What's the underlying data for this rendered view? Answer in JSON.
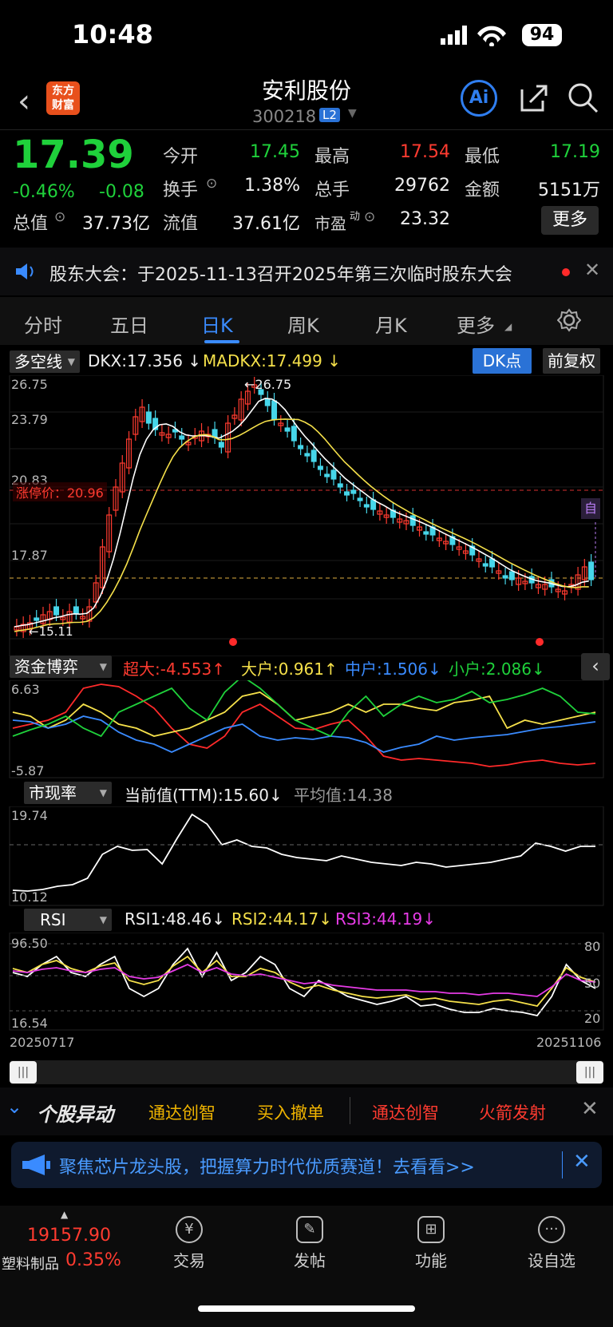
{
  "status": {
    "time": "10:48",
    "battery": "94"
  },
  "header": {
    "logo_line1": "东方",
    "logo_line2": "财富",
    "name": "安利股份",
    "code": "300218",
    "level": "L2",
    "ai": "Ai"
  },
  "quote": {
    "price": "17.39",
    "change_pct": "-0.46%",
    "change": "-0.08",
    "open_label": "今开",
    "open": "17.45",
    "high_label": "最高",
    "high": "17.54",
    "low_label": "最低",
    "low": "17.19",
    "turnover_label": "换手",
    "turnover": "1.38%",
    "volume_label": "总手",
    "volume": "29762",
    "amount_label": "金额",
    "amount": "5151万",
    "mktcap_label": "总值",
    "mktcap": "37.73亿",
    "float_label": "流值",
    "float": "37.61亿",
    "pe_label": "市盈",
    "pe_sup": "动",
    "pe": "23.32",
    "more": "更多"
  },
  "notice": {
    "text": "股东大会：于2025-11-13召开2025年第三次临时股东大会"
  },
  "tabs": [
    {
      "label": "分时"
    },
    {
      "label": "五日"
    },
    {
      "label": "日K"
    },
    {
      "label": "周K"
    },
    {
      "label": "月K"
    },
    {
      "label": "更多"
    }
  ],
  "kline": {
    "indicator_select": "多空线",
    "dkx": "DKX:17.356",
    "madkx": "MADKX:17.499",
    "dk_button": "DK点",
    "adjust_button": "前复权",
    "y_labels": [
      "26.75",
      "23.79",
      "20.83",
      "17.87"
    ],
    "high_marker": "26.75",
    "low_marker": "15.11",
    "limit_label": "涨停价：20.96",
    "self_tag": "自",
    "colors": {
      "up": "#ff3b30",
      "down": "#46d6ea",
      "dkx": "#ffffff",
      "madkx": "#f5e04a"
    }
  },
  "fund": {
    "select": "资金博弈",
    "super": "超大:-4.553",
    "big": "大户:0.961",
    "mid": "中户:1.506",
    "small": "小户:2.086",
    "ymax": "6.63",
    "ymin": "-5.87"
  },
  "pe_panel": {
    "select": "市现率",
    "current": "当前值(TTM):15.60",
    "avg": "平均值:14.38",
    "ymax": "19.74",
    "ymin": "10.12"
  },
  "rsi": {
    "select": "RSI",
    "rsi1": "RSI1:48.46",
    "rsi2": "RSI2:44.17",
    "rsi3": "RSI3:44.19",
    "ymax": "96.50",
    "ymin": "16.54",
    "r80": "80",
    "r50": "50",
    "r20": "20"
  },
  "dates": {
    "start": "20250717",
    "end": "20251106"
  },
  "alerts": {
    "title": "个股异动",
    "items": [
      "通达创智",
      "买入撤单",
      "通达创智",
      "火箭发射"
    ]
  },
  "ad": {
    "text": "聚焦芯片龙头股，把握算力时代优质赛道！去看看>>"
  },
  "nav": {
    "index_value": "19157.90",
    "index_name": "塑料制品",
    "index_pct": "0.35%",
    "items": [
      "交易",
      "发帖",
      "功能",
      "设自选"
    ]
  }
}
